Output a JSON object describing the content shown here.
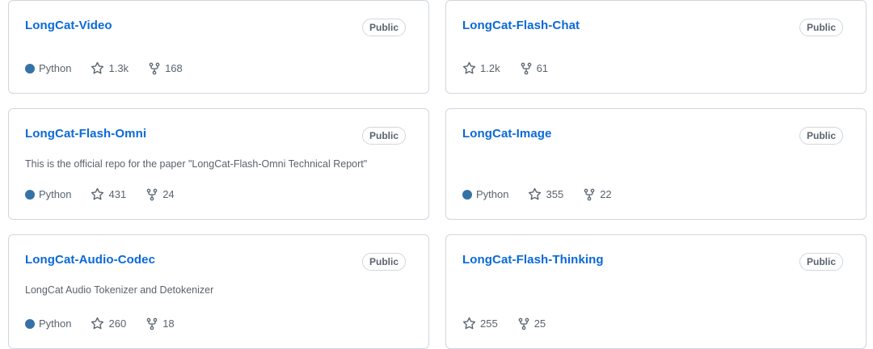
{
  "colors": {
    "link": "#0969da",
    "python": "#3572A5",
    "muted": "#59636e",
    "border": "#d0d7de"
  },
  "repos": [
    {
      "name": "LongCat-Video",
      "visibility": "Public",
      "description": "",
      "language": "Python",
      "stars": "1.3k",
      "forks": "168"
    },
    {
      "name": "LongCat-Flash-Chat",
      "visibility": "Public",
      "description": "",
      "language": "",
      "stars": "1.2k",
      "forks": "61"
    },
    {
      "name": "LongCat-Flash-Omni",
      "visibility": "Public",
      "description": "This is the official repo for the paper \"LongCat-Flash-Omni Technical Report\"",
      "language": "Python",
      "stars": "431",
      "forks": "24"
    },
    {
      "name": "LongCat-Image",
      "visibility": "Public",
      "description": "",
      "language": "Python",
      "stars": "355",
      "forks": "22"
    },
    {
      "name": "LongCat-Audio-Codec",
      "visibility": "Public",
      "description": "LongCat Audio Tokenizer and Detokenizer",
      "language": "Python",
      "stars": "260",
      "forks": "18"
    },
    {
      "name": "LongCat-Flash-Thinking",
      "visibility": "Public",
      "description": "",
      "language": "",
      "stars": "255",
      "forks": "25"
    }
  ],
  "icons": {
    "star": "star-icon",
    "fork": "repo-forked-icon",
    "language": "language-color-dot"
  }
}
